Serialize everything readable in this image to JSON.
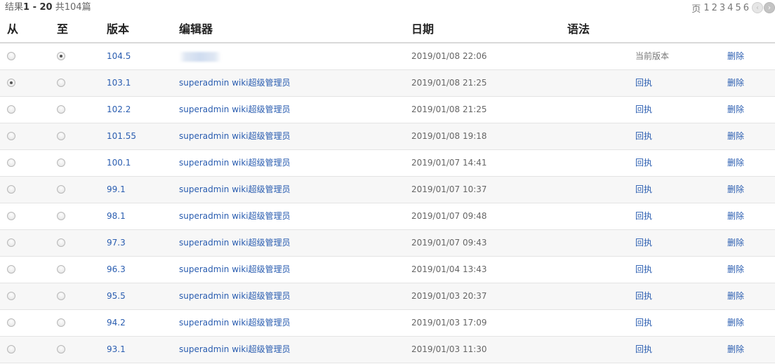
{
  "results": {
    "prefix": "结果",
    "range": "1 - 20",
    "total": "共104篇"
  },
  "pager": {
    "label": "页",
    "pages": [
      "1",
      "2",
      "3",
      "4",
      "5",
      "6"
    ],
    "prev_icon": "chevron-left-icon",
    "next_icon": "chevron-right-icon"
  },
  "columns": {
    "from": "从",
    "to": "至",
    "version": "版本",
    "editor": "编辑器",
    "date": "日期",
    "syntax": "语法"
  },
  "rows": [
    {
      "version": "104.5",
      "editor": "",
      "date": "2019/01/08 22:06",
      "action": "当前版本",
      "action_is_link": false,
      "delete": "删除",
      "from_checked": false,
      "to_checked": true
    },
    {
      "version": "103.1",
      "editor": "superadmin wiki超级管理员",
      "date": "2019/01/08 21:25",
      "action": "回执",
      "action_is_link": true,
      "delete": "删除",
      "from_checked": true,
      "to_checked": false
    },
    {
      "version": "102.2",
      "editor": "superadmin wiki超级管理员",
      "date": "2019/01/08 21:25",
      "action": "回执",
      "action_is_link": true,
      "delete": "删除",
      "from_checked": false,
      "to_checked": false
    },
    {
      "version": "101.55",
      "editor": "superadmin wiki超级管理员",
      "date": "2019/01/08 19:18",
      "action": "回执",
      "action_is_link": true,
      "delete": "删除",
      "from_checked": false,
      "to_checked": false
    },
    {
      "version": "100.1",
      "editor": "superadmin wiki超级管理员",
      "date": "2019/01/07 14:41",
      "action": "回执",
      "action_is_link": true,
      "delete": "删除",
      "from_checked": false,
      "to_checked": false
    },
    {
      "version": "99.1",
      "editor": "superadmin wiki超级管理员",
      "date": "2019/01/07 10:37",
      "action": "回执",
      "action_is_link": true,
      "delete": "删除",
      "from_checked": false,
      "to_checked": false
    },
    {
      "version": "98.1",
      "editor": "superadmin wiki超级管理员",
      "date": "2019/01/07 09:48",
      "action": "回执",
      "action_is_link": true,
      "delete": "删除",
      "from_checked": false,
      "to_checked": false
    },
    {
      "version": "97.3",
      "editor": "superadmin wiki超级管理员",
      "date": "2019/01/07 09:43",
      "action": "回执",
      "action_is_link": true,
      "delete": "删除",
      "from_checked": false,
      "to_checked": false
    },
    {
      "version": "96.3",
      "editor": "superadmin wiki超级管理员",
      "date": "2019/01/04 13:43",
      "action": "回执",
      "action_is_link": true,
      "delete": "删除",
      "from_checked": false,
      "to_checked": false
    },
    {
      "version": "95.5",
      "editor": "superadmin wiki超级管理员",
      "date": "2019/01/03 20:37",
      "action": "回执",
      "action_is_link": true,
      "delete": "删除",
      "from_checked": false,
      "to_checked": false
    },
    {
      "version": "94.2",
      "editor": "superadmin wiki超级管理员",
      "date": "2019/01/03 17:09",
      "action": "回执",
      "action_is_link": true,
      "delete": "删除",
      "from_checked": false,
      "to_checked": false
    },
    {
      "version": "93.1",
      "editor": "superadmin wiki超级管理员",
      "date": "2019/01/03 11:30",
      "action": "回执",
      "action_is_link": true,
      "delete": "删除",
      "from_checked": false,
      "to_checked": false
    }
  ],
  "colors": {
    "link": "#2a5db0",
    "header_rule": "#d9d9d9",
    "row_alt": "#f7f7f7"
  }
}
